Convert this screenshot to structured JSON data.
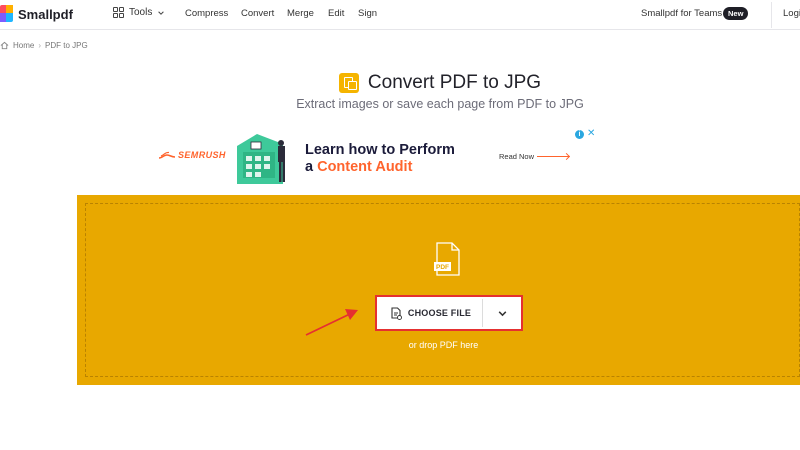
{
  "header": {
    "logo_text": "Smallpdf",
    "tools_label": "Tools",
    "nav": [
      "Compress",
      "Convert",
      "Merge",
      "Edit",
      "Sign"
    ],
    "teams_label": "Smallpdf for Teams",
    "teams_badge": "New",
    "login_label": "Login"
  },
  "breadcrumb": {
    "home": "Home",
    "current": "PDF to JPG"
  },
  "hero": {
    "title": "Convert PDF to JPG",
    "subtitle": "Extract images or save each page from PDF to JPG"
  },
  "ad": {
    "brand": "SEMRUSH",
    "headline_line1": "Learn how to Perform",
    "headline_prefix": "a ",
    "headline_accent": "Content Audit",
    "cta": "Read Now",
    "info_icon": "i",
    "close_icon": "✕"
  },
  "dropzone": {
    "file_icon_label": "PDF",
    "choose_file_label": "CHOOSE FILE",
    "drop_hint": "or drop PDF here"
  },
  "colors": {
    "dropzone_bg": "#e8a800",
    "annotation_red": "#e53030",
    "ad_accent": "#ff642d",
    "title_icon": "#f5b400"
  }
}
